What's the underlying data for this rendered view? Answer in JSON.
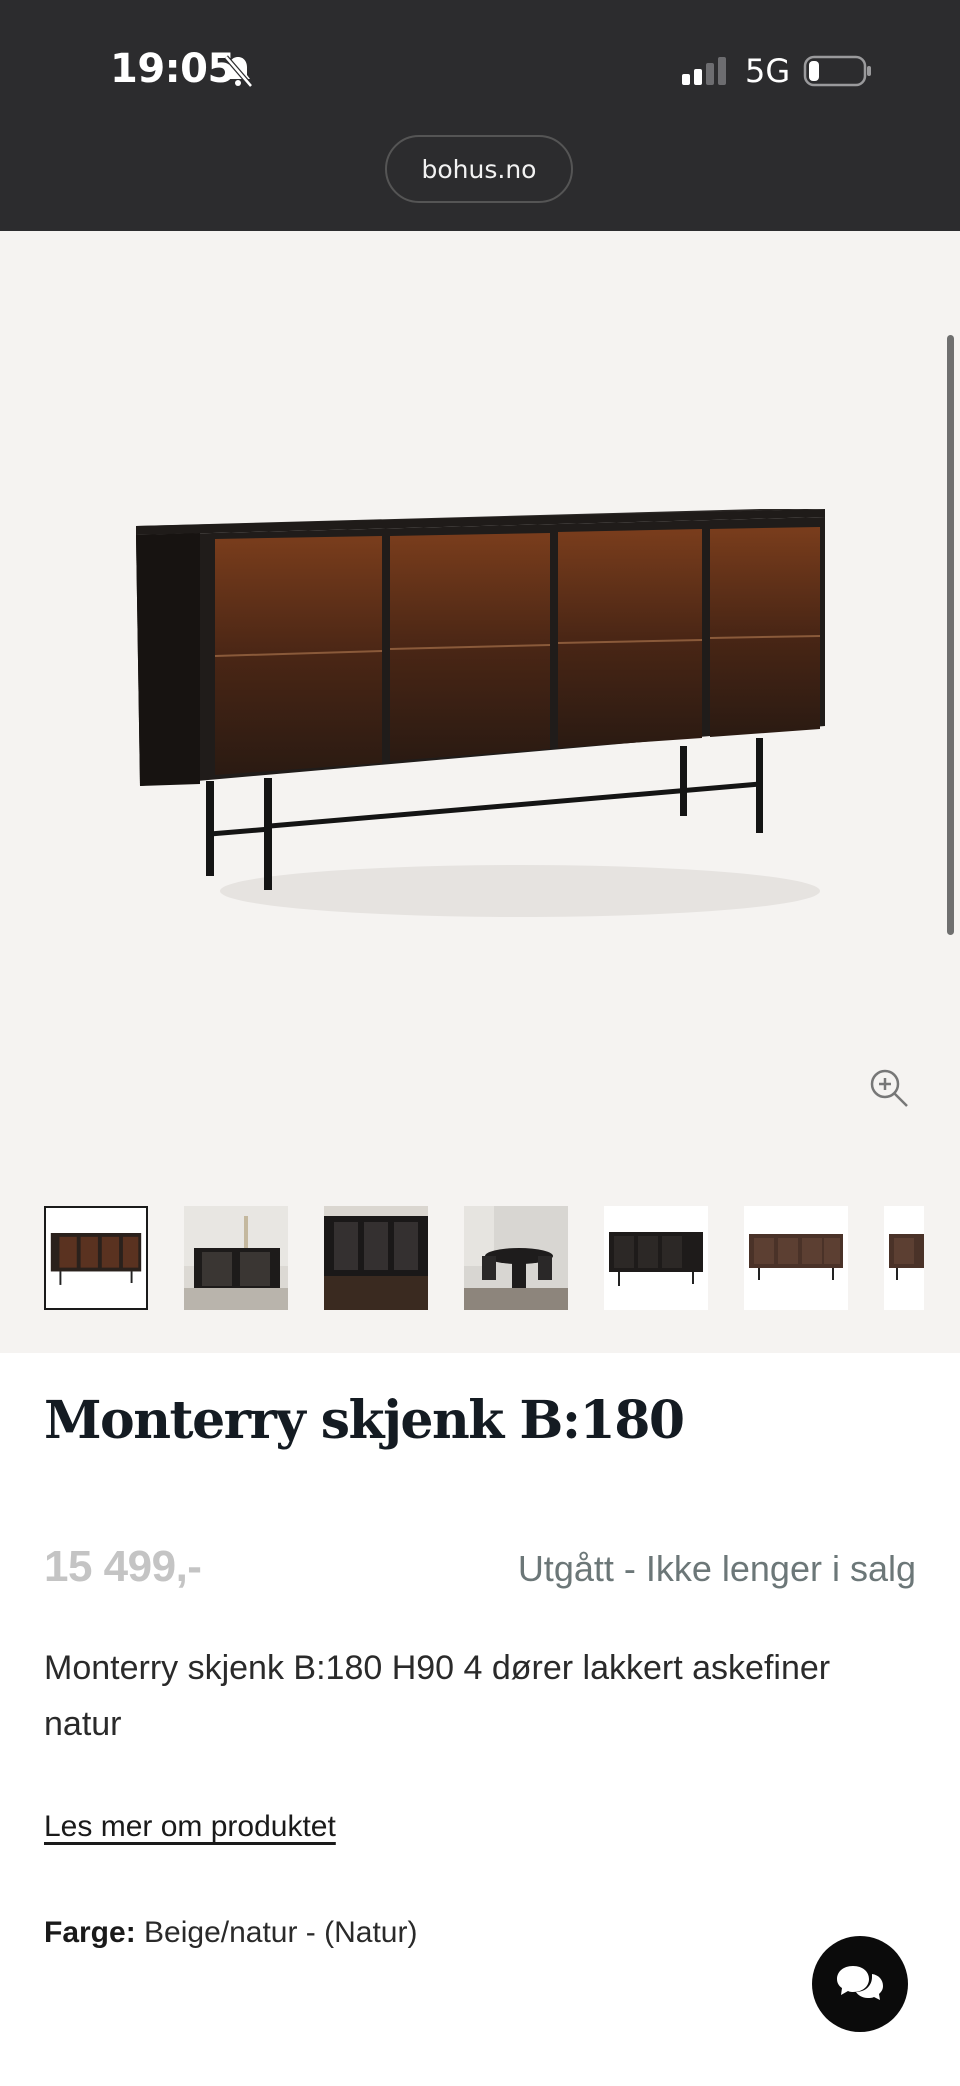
{
  "status_bar": {
    "time": "19:05",
    "network": "5G"
  },
  "browser": {
    "url": "bohus.no"
  },
  "product": {
    "title": "Monterry skjenk B:180",
    "price": "15 499,-",
    "availability": "Utgått - Ikke lenger i salg",
    "description": "Monterry skjenk B:180 H90 4 dører lakkert askefiner natur",
    "read_more": "Les mer om produktet",
    "color_label": "Farge:",
    "color_value": "Beige/natur - (Natur)"
  },
  "gallery": {
    "thumbnail_count": 7,
    "active_index": 0
  },
  "icons": {
    "mute": "bell-slash-icon",
    "zoom": "zoom-in-icon",
    "chat": "chat-bubbles-icon"
  },
  "colors": {
    "topbar": "#2c2c2e",
    "gallery_bg": "#f5f3f1",
    "title": "#141b22",
    "price_disabled": "#c4c4c4",
    "status": "#6c7778"
  }
}
